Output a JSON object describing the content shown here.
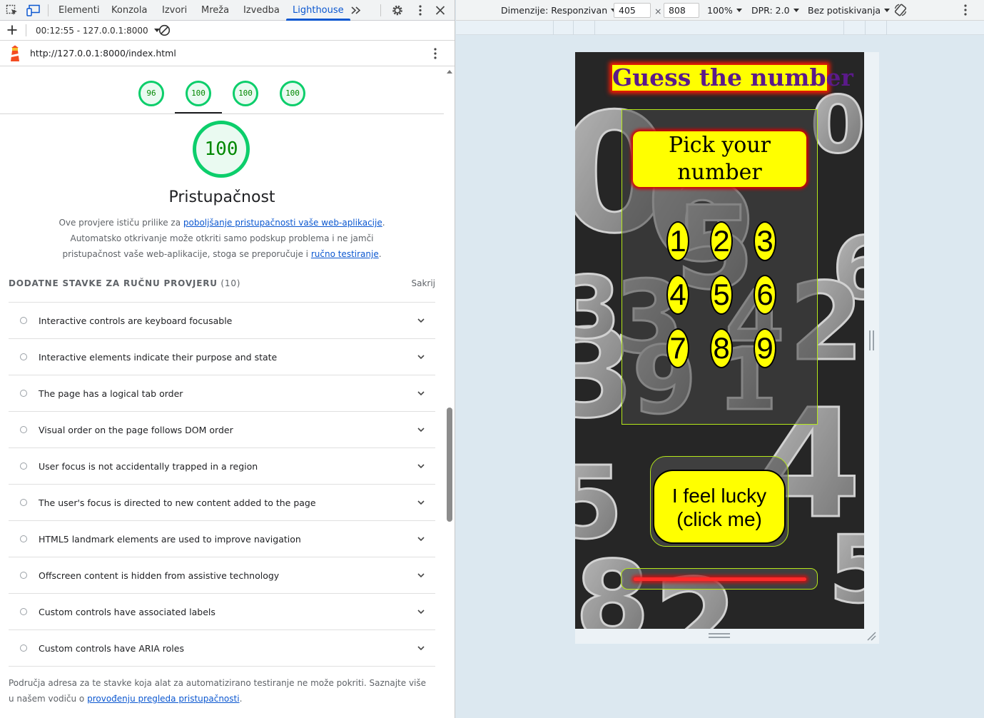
{
  "devtools": {
    "tabs": [
      "Elementi",
      "Konzola",
      "Izvori",
      "Mreža",
      "Izvedba",
      "Lighthouse"
    ],
    "active_tab": "Lighthouse",
    "report_selector": "00:12:55 - 127.0.0.1:8000",
    "url": "http://127.0.0.1:8000/index.html",
    "scores": [
      "96",
      "100",
      "100",
      "100"
    ],
    "main_score": "100",
    "category_title": "Pristupačnost",
    "desc": {
      "p1": "Ove provjere ističu prilike za ",
      "link1": "poboljšanje pristupačnosti vaše web-aplikacije",
      "p2": ". Automatsko otkrivanje može otkriti samo podskup problema i ne jamči pristupačnost vaše web-aplikacije, stoga se preporučuje i ",
      "link2": "ručno testiranje",
      "p3": "."
    },
    "group_title": "DODATNE STAVKE ZA RUČNU PROVJERU",
    "group_count": "(10)",
    "hide_label": "Sakrij",
    "audits": [
      "Interactive controls are keyboard focusable",
      "Interactive elements indicate their purpose and state",
      "The page has a logical tab order",
      "Visual order on the page follows DOM order",
      "User focus is not accidentally trapped in a region",
      "The user's focus is directed to new content added to the page",
      "HTML5 landmark elements are used to improve navigation",
      "Offscreen content is hidden from assistive technology",
      "Custom controls have associated labels",
      "Custom controls have ARIA roles"
    ],
    "footer": {
      "p1": "Područja adresa za te stavke koja alat za automatizirano testiranje ne može pokriti. Saznajte više u našem vodiču o ",
      "link": "provođenju pregleda pristupačnosti",
      "p2": "."
    }
  },
  "device_toolbar": {
    "dimensions_label": "Dimenzije: Responzivan",
    "width": "405",
    "height": "808",
    "times": "×",
    "zoom": "100%",
    "dpr": "DPR: 2.0",
    "throttle": "Bez potiskivanja"
  },
  "game": {
    "title": "Guess the number",
    "pick_text": "Pick your number",
    "numbers": [
      "1",
      "2",
      "3",
      "4",
      "5",
      "6",
      "7",
      "8",
      "9"
    ],
    "lucky_button": "I feel lucky (click me)",
    "background_numbers": [
      "0",
      "6",
      "0",
      "6",
      "3",
      "4",
      "2",
      "5",
      "9",
      "1",
      "4",
      "5",
      "8",
      "2",
      "5",
      "3",
      "3"
    ]
  },
  "colors": {
    "accent": "#0b57d0",
    "score_green": "#0cce6b",
    "game_yellow": "#ffff00",
    "game_title_text": "#5b1a8a",
    "panel_border": "#b5e81a"
  }
}
